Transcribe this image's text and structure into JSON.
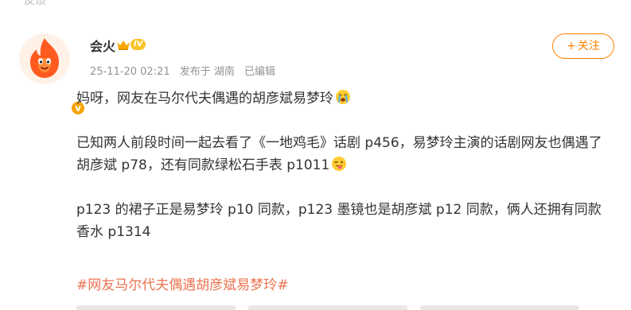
{
  "top_fragment": "反馈",
  "post": {
    "author": {
      "name": "会火",
      "level": "IV",
      "verified_mark": "v"
    },
    "meta": {
      "timestamp": "25-11-20 02:21",
      "location": "发布于 湖南",
      "edited": "已编辑"
    },
    "follow_button": {
      "icon": "+",
      "label": "关注"
    },
    "paragraphs": [
      {
        "text": "妈呀，网友在马尔代夫偶遇的胡彦斌易梦玲",
        "emoji": "crying-emoji"
      },
      {
        "text": "已知两人前段时间一起去看了《一地鸡毛》话剧 p456，易梦玲主演的话剧网友也偶遇了胡彦斌 p78，还有同款绿松石手表 p1011",
        "emoji": "tongue-emoji"
      },
      {
        "text": "p123 的裙子正是易梦玲 p10 同款，p123 墨镜也是胡彦斌 p12 同款，俩人还拥有同款香水 p1314",
        "emoji": ""
      }
    ],
    "hashtag": "#网友马尔代夫偶遇胡彦斌易梦玲#"
  },
  "colors": {
    "accent": "#ff8200",
    "hashtag": "#eb7350",
    "meta_text": "#939393",
    "body_text": "#333333",
    "badge": "#f7a400"
  }
}
